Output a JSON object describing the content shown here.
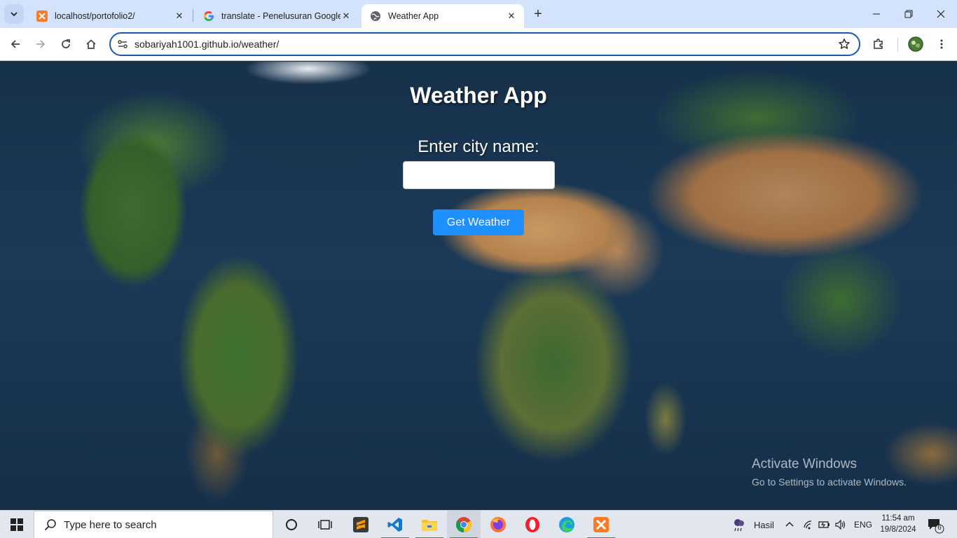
{
  "browser": {
    "tabs": [
      {
        "label": "localhost/portofolio2/",
        "icon": "xampp-icon"
      },
      {
        "label": "translate - Penelusuran Google",
        "icon": "google-icon"
      },
      {
        "label": "Weather App",
        "icon": "globe-icon",
        "active": true
      }
    ],
    "url": "sobariyah1001.github.io/weather/"
  },
  "page": {
    "title": "Weather App",
    "city_label": "Enter city name:",
    "city_input_value": "",
    "button_label": "Get Weather"
  },
  "watermark": {
    "line1": "Activate Windows",
    "line2": "Go to Settings to activate Windows."
  },
  "taskbar": {
    "search_placeholder": "Type here to search",
    "weather_text": "Hasil",
    "language": "ENG",
    "time": "11:54 am",
    "date": "19/8/2024",
    "notification_count": "6"
  },
  "colors": {
    "accent_button": "#1e90ff",
    "tabstrip": "#d3e3fd",
    "omnibox_border": "#1a57b3"
  }
}
